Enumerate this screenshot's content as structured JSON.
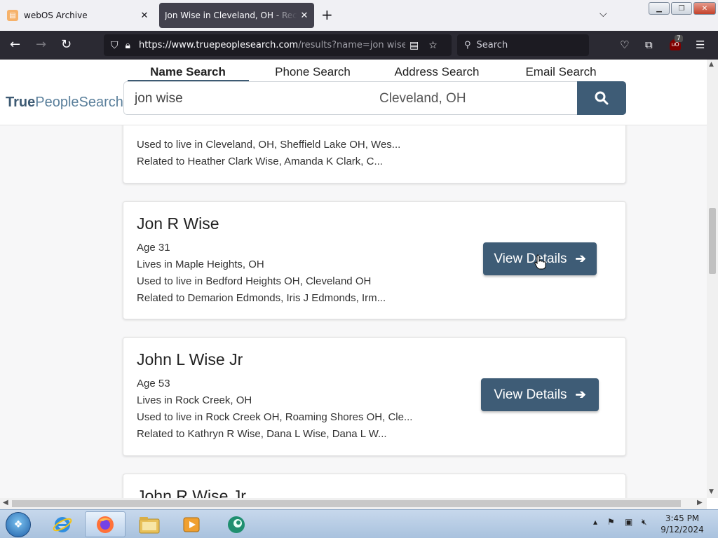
{
  "browser": {
    "tabs": [
      {
        "title": "webOS Archive",
        "active": false
      },
      {
        "title": "Jon Wise in Cleveland, OH - Records",
        "active": true
      }
    ],
    "url_main": "https://www.truepeoplesearch.com",
    "url_rest": "/results?name=jon wise&c",
    "search_placeholder": "Search",
    "extension_badge": "7",
    "ublock_label": "uO"
  },
  "site": {
    "logo_bold": "True",
    "logo_light": "PeopleSearch",
    "tabs": [
      "Name Search",
      "Phone Search",
      "Address Search",
      "Email Search"
    ],
    "name_value": "jon wise",
    "location_value": "Cleveland, OH"
  },
  "results": [
    {
      "name": "",
      "lines": [
        "Used to live in Cleveland, OH, Sheffield Lake OH, Wes...",
        "Related to Heather Clark Wise, Amanda K Clark, C..."
      ]
    },
    {
      "name": "Jon R Wise",
      "lines": [
        "Age 31",
        "Lives in Maple Heights, OH",
        "Used to live in Bedford Heights OH, Cleveland OH",
        "Related to Demarion Edmonds, Iris J Edmonds, Irm..."
      ],
      "button": "View Details"
    },
    {
      "name": "John L Wise Jr",
      "lines": [
        "Age 53",
        "Lives in Rock Creek, OH",
        "Used to live in Rock Creek OH, Roaming Shores OH, Cle...",
        "Related to Kathryn R Wise, Dana L Wise, Dana L W..."
      ],
      "button": "View Details"
    },
    {
      "name": "John R Wise Jr",
      "lines": []
    }
  ],
  "taskbar": {
    "time": "3:45 PM",
    "date": "9/12/2024"
  },
  "colors": {
    "accent": "#3e5c76",
    "browser_dark": "#2b2a33"
  }
}
